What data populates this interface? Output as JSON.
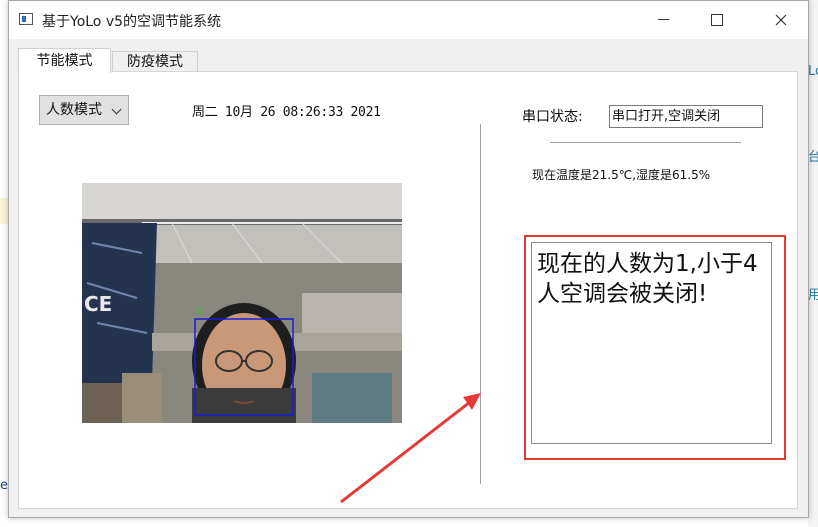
{
  "window": {
    "title": "基于YoLo v5的空调节能系统"
  },
  "tabs": [
    {
      "label": "节能模式",
      "selected": true
    },
    {
      "label": "防疫模式",
      "selected": false
    }
  ],
  "controls": {
    "mode_select": "人数模式",
    "datetime": "周二 10月 26 08:26:33 2021"
  },
  "video": {
    "detection_label": "1",
    "box_color": "#1a1ad8",
    "label_color": "#18d018"
  },
  "serial": {
    "label": "串口状态:",
    "value": "串口打开,空调关闭"
  },
  "environment": {
    "text": "现在温度是21.5℃,湿度是61.5%"
  },
  "message": {
    "text": "现在的人数为1,小于4人空调会被关闭!"
  },
  "background": {
    "left_text": "es",
    "right_fragments": [
      "Lo",
      "台",
      "用"
    ]
  },
  "colors": {
    "highlight": "#e53935",
    "accent_blue": "#2d6db3"
  },
  "icons": {
    "minimize": "minimize-icon",
    "maximize": "maximize-icon",
    "close": "close-icon"
  }
}
